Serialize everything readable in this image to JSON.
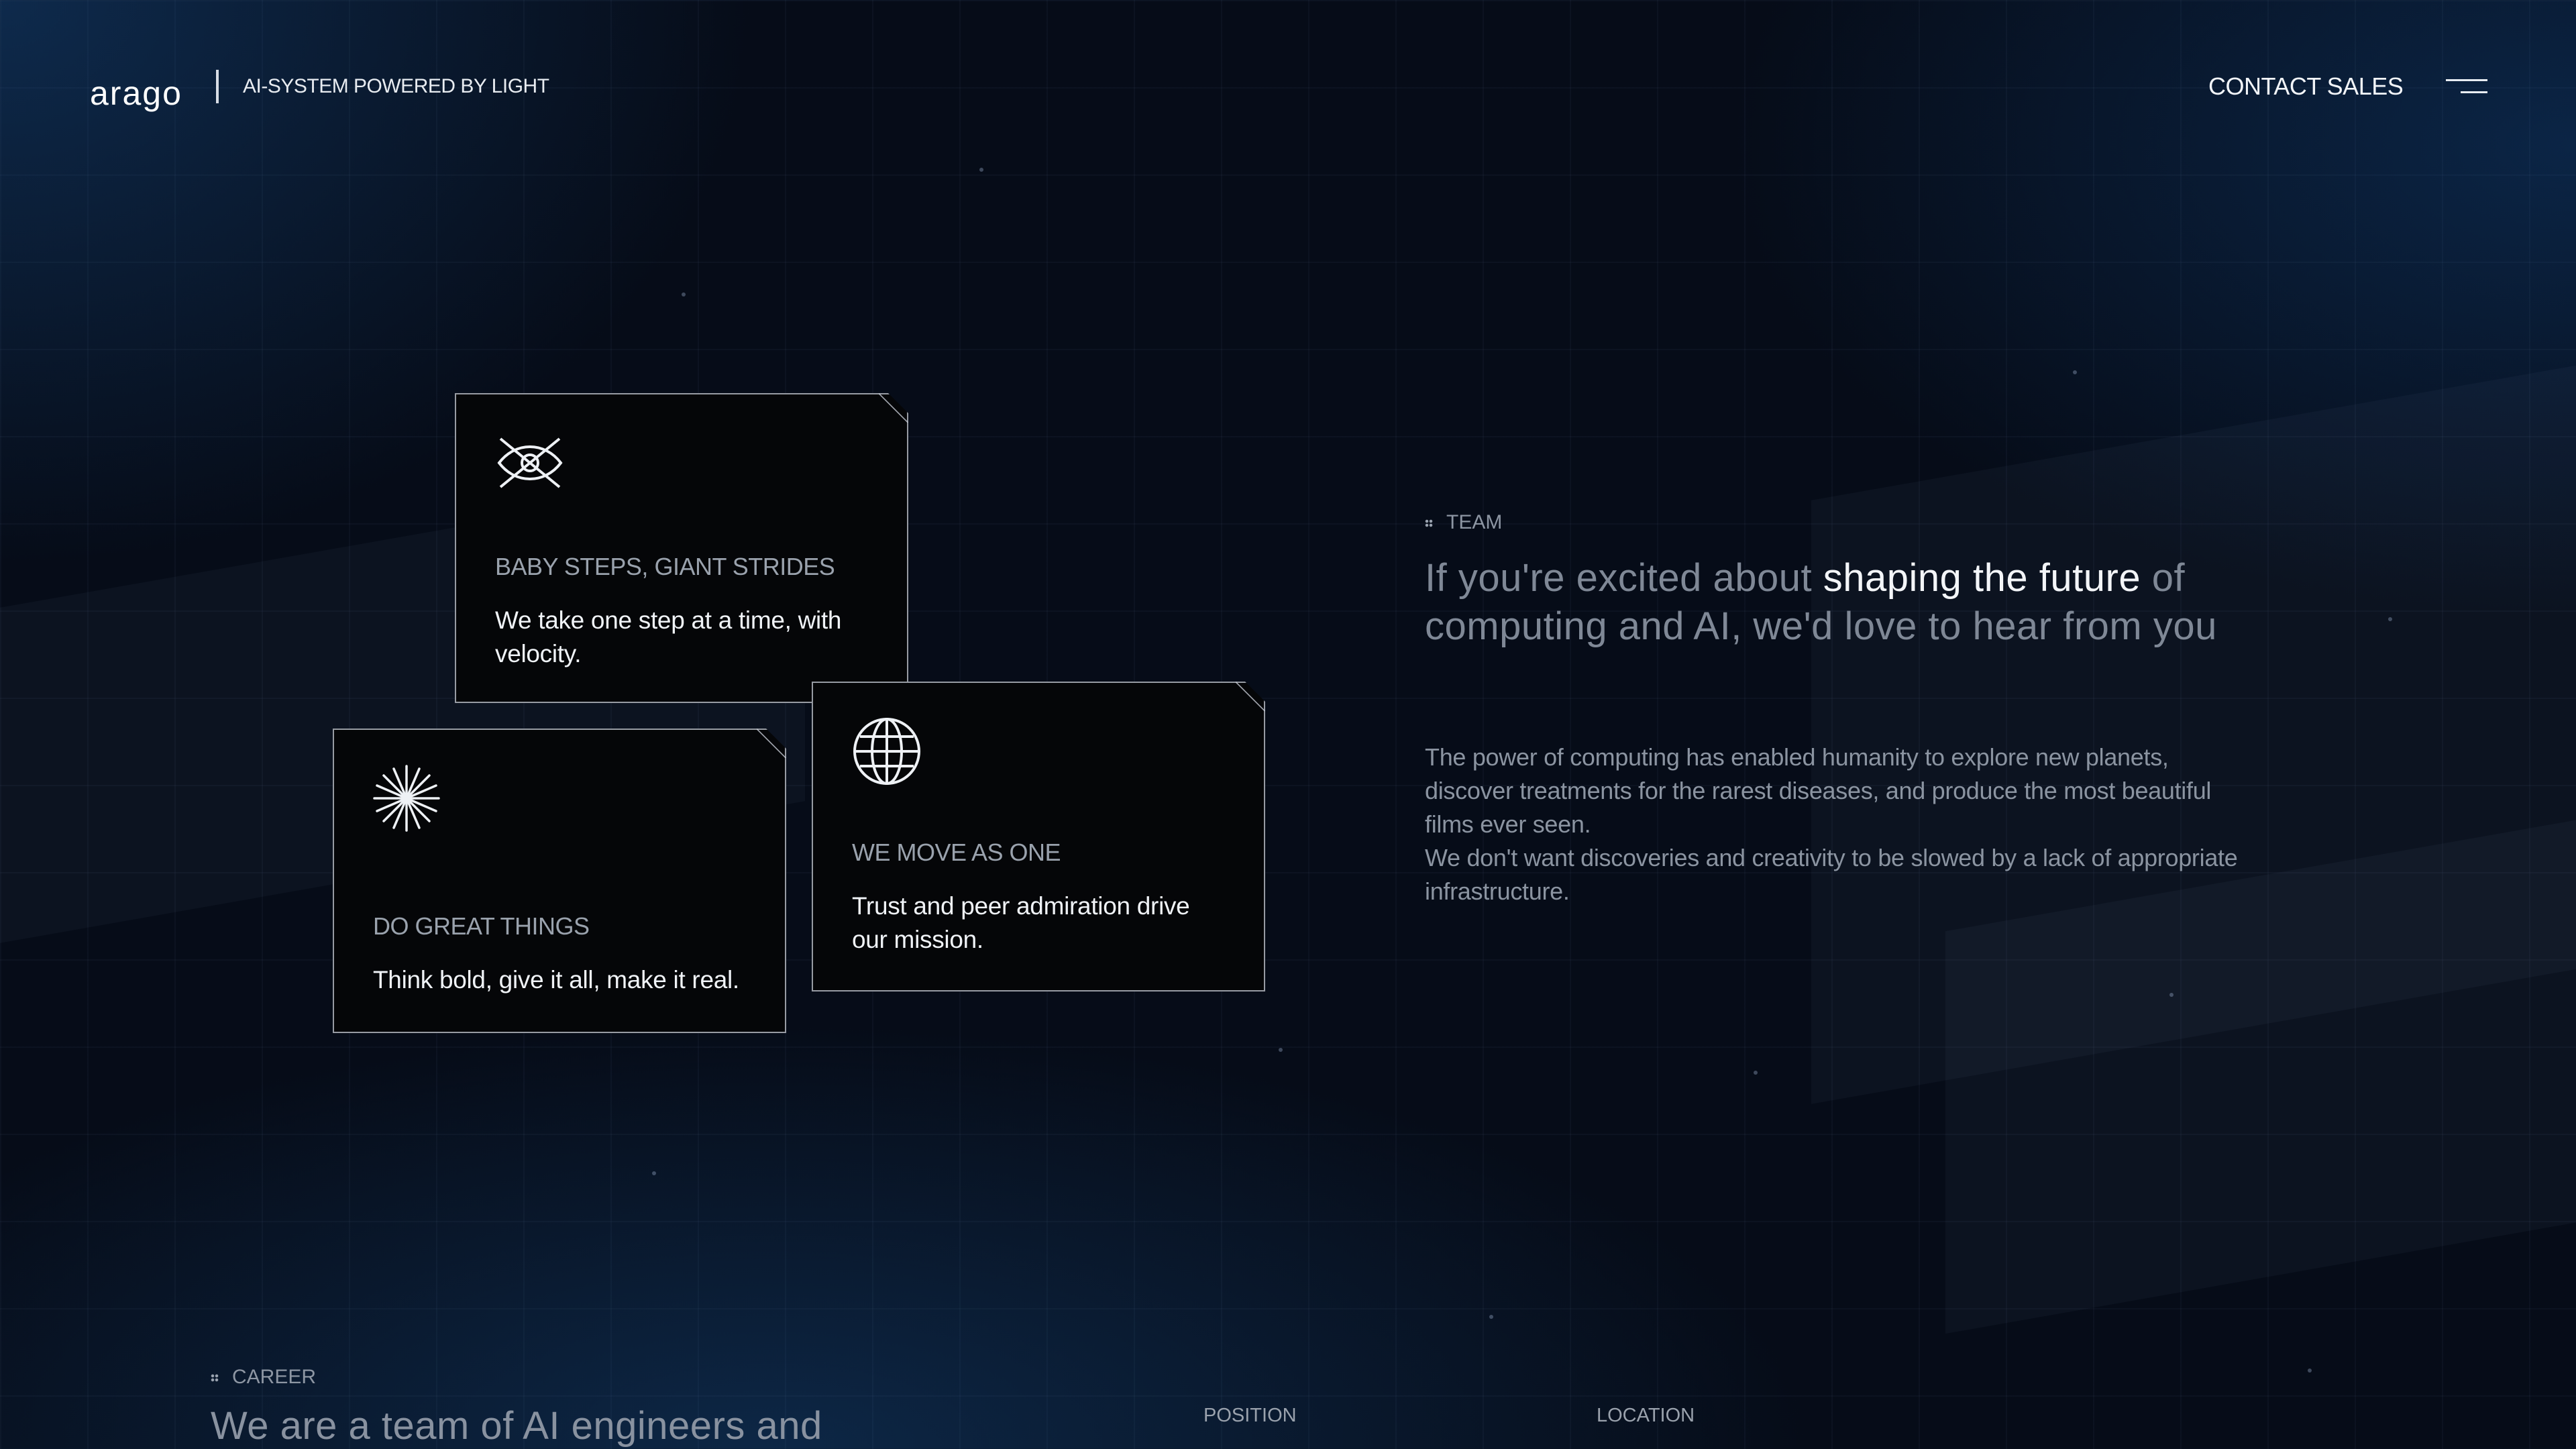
{
  "header": {
    "logo": "arago",
    "tagline": "AI-SYSTEM POWERED BY LIGHT",
    "contact": "CONTACT SALES",
    "menu_icon": "hamburger-icon"
  },
  "cards": [
    {
      "icon": "eye-icon",
      "title": "BABY STEPS, GIANT STRIDES",
      "body": "We take one step at a time, with velocity."
    },
    {
      "icon": "sparkle-icon",
      "title": "DO GREAT THINGS",
      "body": "Think bold, give it all, make it real."
    },
    {
      "icon": "globe-icon",
      "title": "WE MOVE AS ONE",
      "body": "Trust and peer admiration drive our mission."
    }
  ],
  "team": {
    "label": "TEAM",
    "heading_pre": "If you're excited about ",
    "heading_highlight": "shaping the future",
    "heading_post": " of computing and AI, we'd love to hear from you",
    "paragraph_1": "The power of computing has enabled humanity to explore new planets, discover treatments for the rarest diseases, and produce the most beautiful films ever seen.",
    "paragraph_2": "We don't want discoveries and creativity to be slowed by a lack of appropriate infrastructure."
  },
  "career": {
    "label": "CAREER",
    "heading": "We are a team of AI engineers and",
    "col_position": "POSITION",
    "col_location": "LOCATION"
  },
  "colors": {
    "background": "#060c18",
    "accent_text": "#f3f5f8",
    "muted_text": "#8b94a1"
  }
}
